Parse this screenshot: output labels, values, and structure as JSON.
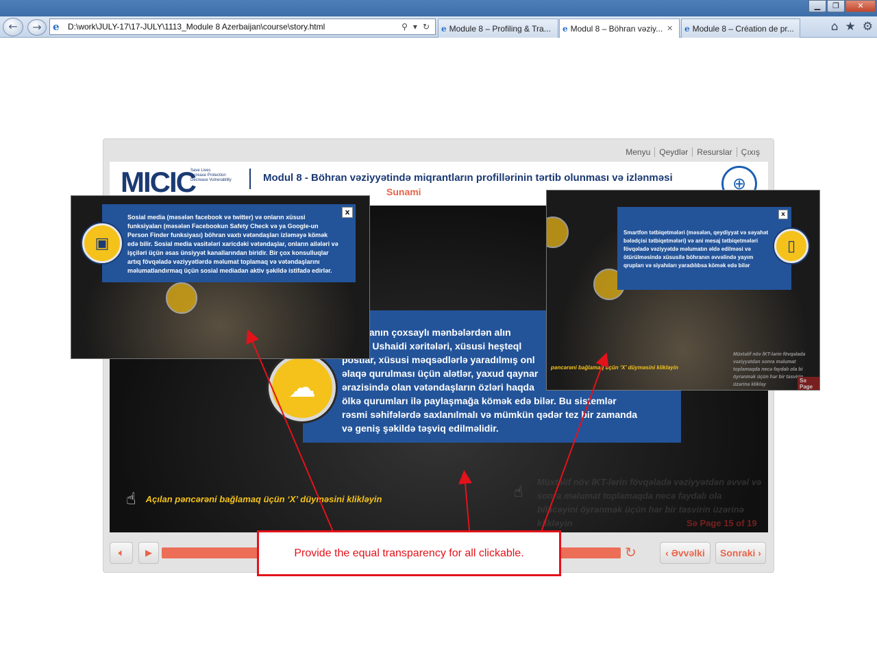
{
  "browser": {
    "address": "D:\\work\\JULY-17\\17-JULY\\1113_Module 8 Azerbaijan\\course\\story.html",
    "tabs": [
      {
        "label": "Module 8 – Profiling & Tra..."
      },
      {
        "label": "Modul 8 – Böhran vəziy..."
      },
      {
        "label": "Module 8 – Création de pr..."
      }
    ]
  },
  "player": {
    "menu": [
      "Menyu",
      "Qeydlər",
      "Resurslar",
      "Çıxış"
    ],
    "header_title": "Modul 8 - Böhran vəziyyətində miqrantların profillərinin tərtib olunması və izlənməsi",
    "header_subtitle": "Sunami",
    "logo_text": "MICIC",
    "logo_tagline": [
      "Save Lives",
      "Increase Protection",
      "Decrease Vulnerability"
    ],
    "main_text": "...masiyanın çoxsaylı mənbələrdən alın... ...mələn Ushaidi xəritələri, xüsusi heşteql... postlar, xüsusi məqsədlərlə yaradılmış onl... əlaqə qurulması üçün alətlər, yaxud qaynar... ərazisində olan vətəndaşların özləri haqda... ölkə qurumları ilə paylaşmağa kömək edə bilər. Bu sistemlər rəsmi səhifələrdə saxlanılmalı və mümkün qədər tez bir zamanda və geniş şəkildə təşviq edilməlidir.",
    "main_lines": [
      "masiyanın  çoxsaylı mənbələrdən alın",
      "mələn Ushaidi xəritələri, xüsusi heşteql",
      "postlar, xüsusi məqsədlərlə yaradılmış onl",
      "əlaqə qurulması üçün alətlər, yaxud qaynar",
      "ərazisində olan vətəndaşların özləri haqda",
      "ölkə qurumları ilə paylaşmağa kömək edə bilər. Bu sistemlər",
      "rəsmi səhifələrdə saxlanılmalı və mümkün qədər tez bir zamanda",
      "və geniş şəkildə təşviq edilməlidir."
    ],
    "hint": "Açılan pəncərəni bağlamaq üçün  ‘X’ düyməsini klikləyin",
    "faded_hint": "Müxtəlif növ İKT-lərin fövqəladə vəziyyətdən əvvəl və sonra məlumat toplamaqda necə faydalı ola biləcəyini öyrənmək üçün hər bir təsvirin üzərinə klikləyin",
    "page": "Sə Page 15 of 19",
    "prev_label": "Əvvəlki",
    "next_label": "Sonraki"
  },
  "popup_left": {
    "text": "Sosial media (məsələn facebook və twitter) və onların xüsusi funksiyaları (məsələn Facebookun Safety Check və ya Google-un Person Finder funksiyası) böhran vaxtı vətəndaşları izləməyə kömək edə bilir. Sosial media vasitələri xaricdəki vətəndaşlar, onların ailələri və işçiləri üçün əsas ünsiyyət kanallarından biridir. Bir çox konsulluqlar artıq fövqəladə vəziyyətlərdə məlumat toplamaq və vətəndaşlarını məlumatlandırmaq üçün sosial mediadan aktiv şəkildə istifadə edirlər.",
    "close": "x"
  },
  "popup_right": {
    "text": "Smartfon tətbiqetmələri (məsələn, qeydiyyat və səyahət bələdçisi tətbiqetmələri) və ani mesaj tətbiqetmələri fövqəladə vəziyyətdə məlumatın əldə edilməsi və ötürülməsində xüsusilə böhranın əvvəlində yayım qrupları və siyahıları yaradılıbsa kömək edə bilər",
    "close": "x",
    "hint": "pəncərəni bağlamaq üçün  ‘X’ düyməsini klikləyin",
    "faded_hint": "Müxtəlif növ İKT-lərin fövqəladə vəziyyətdən sonra məlumat toplamaqda necə faydalı ola bi öyrənmək üçün hər bir təsvirin üzərinə klikləy",
    "page": "Sə Page"
  },
  "annotation": {
    "text": "Provide the equal transparency for all clickable.",
    "color": "#e3121b"
  },
  "icons": [
    "back-icon",
    "forward-icon",
    "ie-icon",
    "search-icon",
    "refresh-icon",
    "home-icon",
    "star-icon",
    "gear-icon",
    "mute-icon",
    "play-icon",
    "replay-icon",
    "hand-icon",
    "computer-icon",
    "phone-icon",
    "browser-window-icon",
    "close-icon"
  ]
}
